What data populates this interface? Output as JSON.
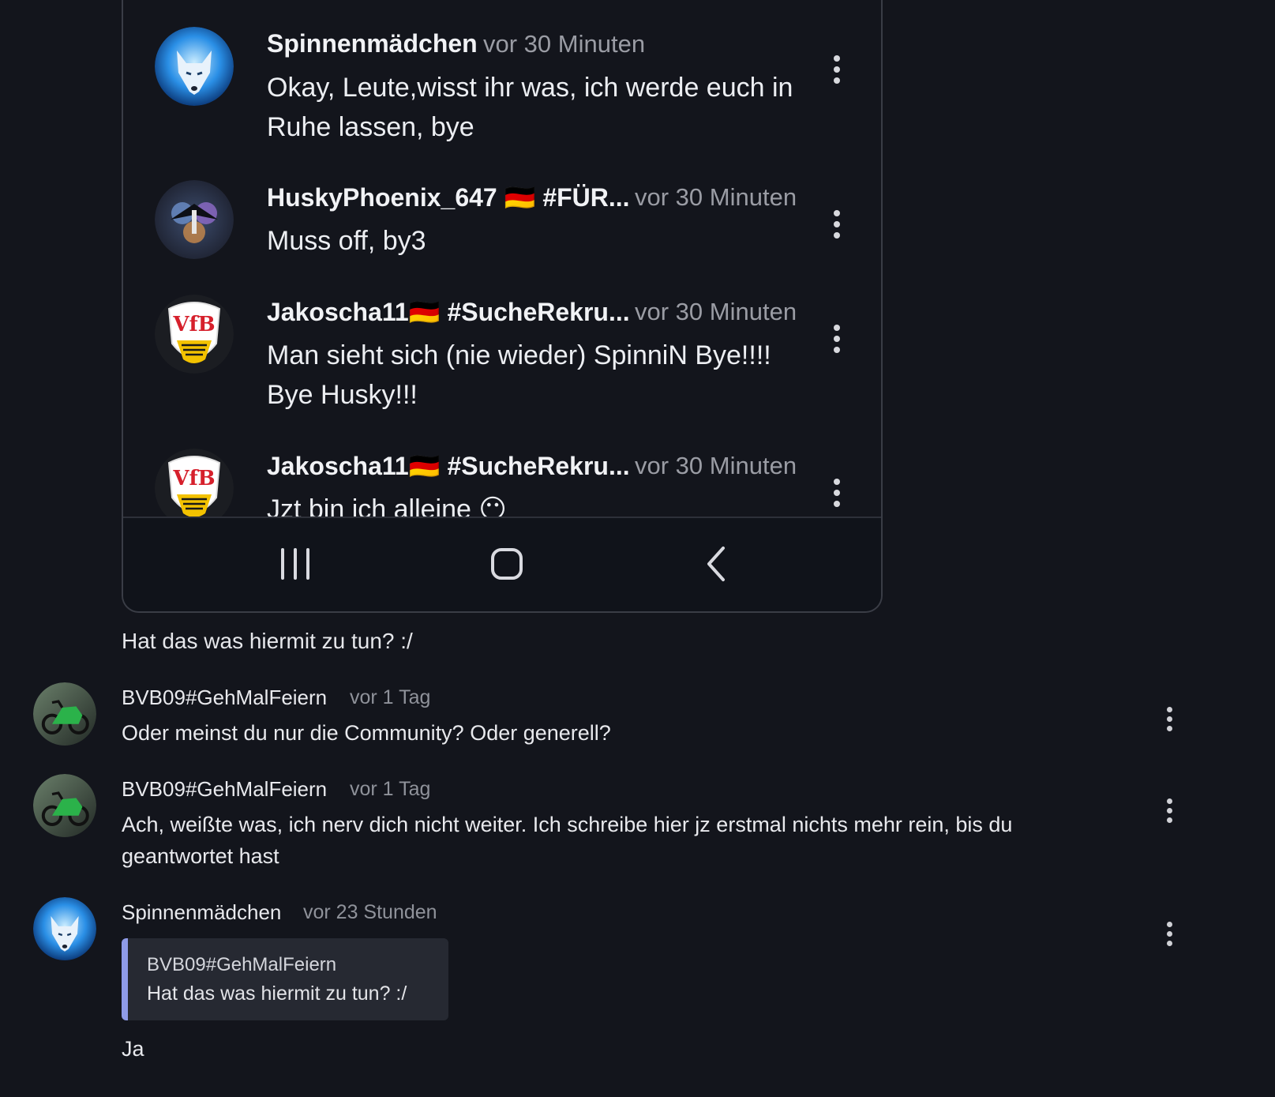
{
  "embedded_screenshot": {
    "messages": [
      {
        "author": "Spinnenmädchen",
        "time": "vor 30 Minuten",
        "text": "Okay, Leute,wisst ihr was, ich werde euch in Ruhe lassen, bye",
        "avatar": "wolf-avatar"
      },
      {
        "author": "HuskyPhoenix_647 🇩🇪 #FÜR...",
        "time": "vor 30 Minuten",
        "text": "Muss off, by3",
        "avatar": "phoenix-avatar"
      },
      {
        "author": "Jakoscha11🇩🇪 #SucheRekru...",
        "time": "vor 30 Minuten",
        "text": "Man sieht sich (nie wieder) SpinniN Bye!!!! Bye Husky!!!",
        "avatar": "vfb-crest-avatar"
      },
      {
        "author": "Jakoscha11🇩🇪 #SucheRekru...",
        "time": "vor 30 Minuten",
        "text": "Jzt bin ich alleine 😶",
        "avatar": "vfb-crest-avatar"
      }
    ],
    "nav_buttons": [
      "recent-apps-icon",
      "home-icon",
      "back-icon"
    ]
  },
  "caption": "Hat das was hiermit zu tun? :/",
  "comments": [
    {
      "author": "BVB09#GehMalFeiern",
      "time": "vor 1 Tag",
      "text": "Oder meinst du nur die Community? Oder generell?",
      "avatar": "motorcycle-avatar"
    },
    {
      "author": "BVB09#GehMalFeiern",
      "time": "vor 1 Tag",
      "text": "Ach, weißte was, ich nerv dich nicht weiter. Ich schreibe hier jz erstmal nichts mehr rein, bis du geantwortet hast",
      "avatar": "motorcycle-avatar"
    },
    {
      "author": "Spinnenmädchen",
      "time": "vor 23 Stunden",
      "quote": {
        "author": "BVB09#GehMalFeiern",
        "text": "Hat das was hiermit zu tun? :/"
      },
      "text": "Ja",
      "avatar": "wolf-avatar"
    }
  ],
  "colors": {
    "background": "#13151c",
    "quote_accent": "#8f9be8",
    "muted_text": "#8f929a"
  }
}
